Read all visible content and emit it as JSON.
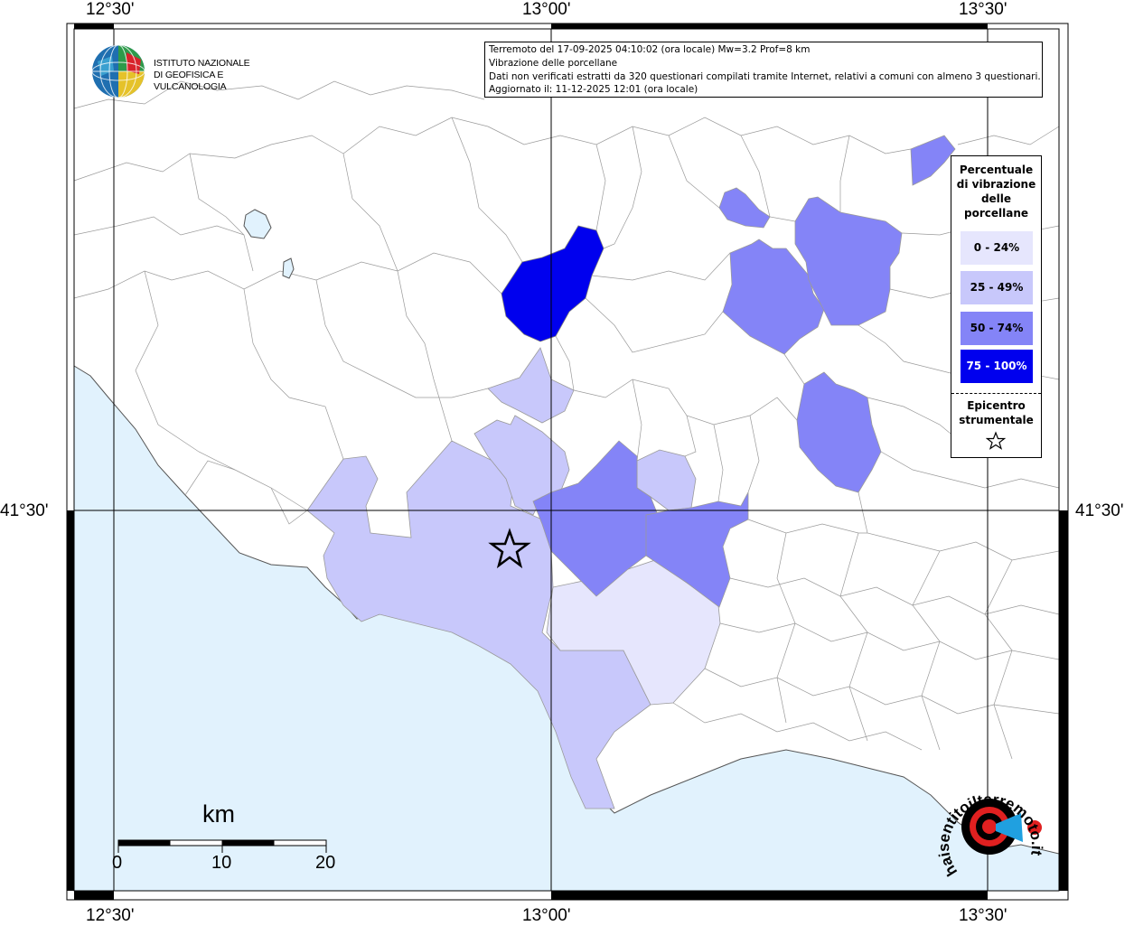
{
  "info": {
    "line1": "Terremoto del 17-09-2025 04:10:02 (ora locale) Mw=3.2 Prof=8 km",
    "line2": "Vibrazione delle porcellane",
    "line3": "Dati non verificati estratti da 320 questionari compilati tramite Internet, relativi a comuni con almeno 3 questionari.",
    "line4": "Aggiornato il: 11-12-2025 12:01 (ora locale)"
  },
  "logo": {
    "line1": "ISTITUTO NAZIONALE",
    "line2": "DI GEOFISICA E VULCANOLOGIA"
  },
  "coords": {
    "top": [
      "12°30'",
      "13°00'",
      "13°30'"
    ],
    "bottom": [
      "12°30'",
      "13°00'",
      "13°30'"
    ],
    "left": "41°30'",
    "right": "41°30'"
  },
  "legend": {
    "title_lines": [
      "Percentuale",
      "di vibrazione",
      "delle",
      "porcellane"
    ],
    "classes": [
      {
        "label": "0 - 24%",
        "color": "#e6e6fd",
        "text_color": "#000000"
      },
      {
        "label": "25 - 49%",
        "color": "#c8c8fb",
        "text_color": "#000000"
      },
      {
        "label": "50 - 74%",
        "color": "#8484f7",
        "text_color": "#000000"
      },
      {
        "label": "75 - 100%",
        "color": "#0000ee",
        "text_color": "#ffffff"
      }
    ],
    "epicenter_lines": [
      "Epicentro",
      "strumentale"
    ],
    "epicenter_icon": "star-icon"
  },
  "scale": {
    "unit": "km",
    "ticks": [
      "0",
      "10",
      "20"
    ]
  },
  "watermark": {
    "text": "haisentitoilterremoto.it",
    "icon": "seismograph-logo-icon"
  },
  "colors": {
    "sea": "#e1f2fd",
    "land": "#ffffff",
    "border": "#8c8c8c"
  }
}
